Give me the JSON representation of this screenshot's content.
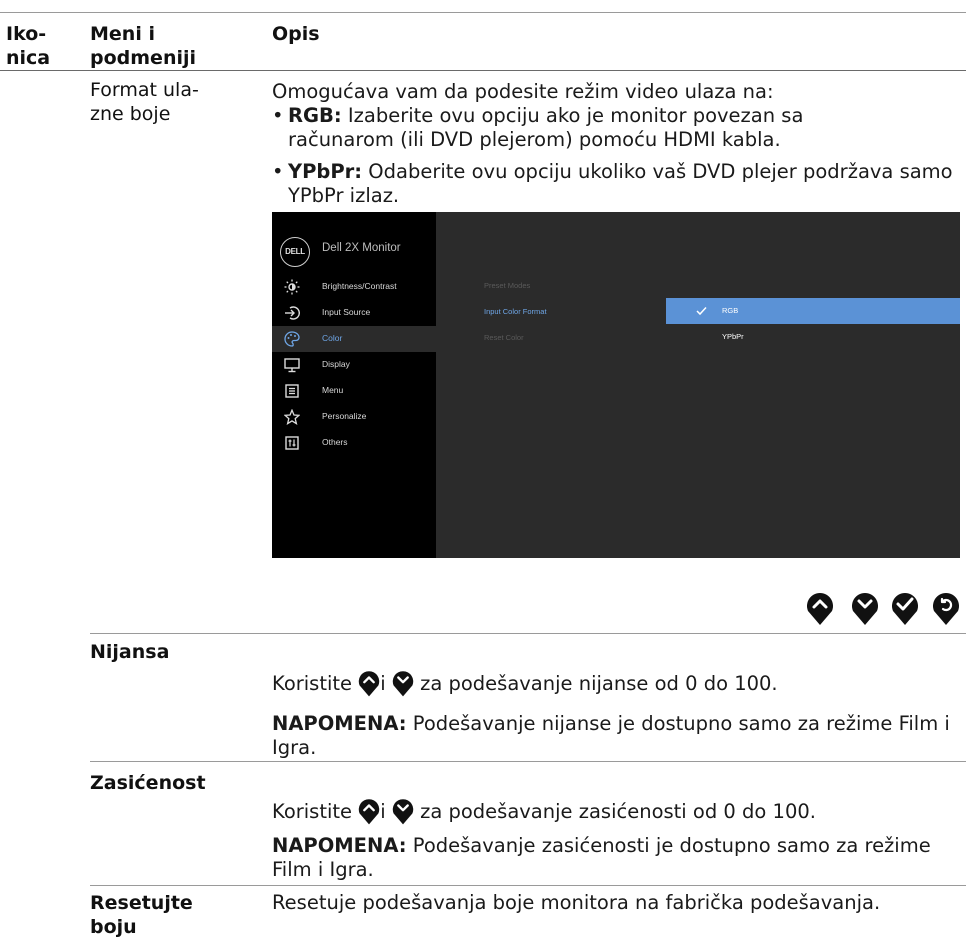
{
  "header": {
    "col1": "Iko-\nnica",
    "col2": "Meni i\npodmeniji",
    "col3": "Opis"
  },
  "rows": {
    "format": {
      "name": "Format ula-\nzne boje",
      "intro": "Omogućava vam da podesite režim video ulaza na:",
      "rgb_label": "RGB:",
      "rgb_text": " Izaberite ovu opciju ako je monitor povezan sa računarom (ili DVD plejerom) pomoću HDMI kabla.",
      "ypbpr_label": "YPbPr:",
      "ypbpr_text": " Odaberite ovu opciju ukoliko vaš DVD plejer podržava samo YPbPr izlaz."
    },
    "hue": {
      "name": "Nijansa",
      "use_pre": "Koristite",
      "use_and": "i",
      "use_post": "za podešavanje nijanse od 0 do 100.",
      "note_label": "NAPOMENA:",
      "note_text": " Podešavanje nijanse je dostupno samo za režime Film i Igra."
    },
    "saturation": {
      "name": "Zasićenost",
      "use_pre": "Koristite",
      "use_and": "i",
      "use_post": "za podešavanje zasićenosti od 0 do 100.",
      "note_label": "NAPOMENA:",
      "note_text": " Podešavanje zasićenosti je dostupno samo za režime Film i Igra."
    },
    "reset": {
      "name": "Resetujte\nboju",
      "text": "Resetuje podešavanja boje monitora na fabrička podešavanja."
    }
  },
  "osd": {
    "logo": "DELL",
    "title": "Dell 2X Monitor",
    "menu": [
      {
        "label": "Brightness/Contrast",
        "icon": "brightness-icon"
      },
      {
        "label": "Input Source",
        "icon": "input-source-icon"
      },
      {
        "label": "Color",
        "icon": "color-icon"
      },
      {
        "label": "Display",
        "icon": "display-icon"
      },
      {
        "label": "Menu",
        "icon": "menu-icon"
      },
      {
        "label": "Personalize",
        "icon": "star-icon"
      },
      {
        "label": "Others",
        "icon": "others-icon"
      }
    ],
    "submenu": [
      "Preset Modes",
      "Input Color Format",
      "Reset Color"
    ],
    "options": [
      "RGB",
      "YPbPr"
    ],
    "colors": {
      "accent": "#5b92d6",
      "selected_text": "#6fa6e6"
    }
  },
  "buttons": [
    "up-icon",
    "down-icon",
    "check-icon",
    "back-icon"
  ],
  "colors": {
    "button": "#111111",
    "rule": "#9a9a9a"
  }
}
